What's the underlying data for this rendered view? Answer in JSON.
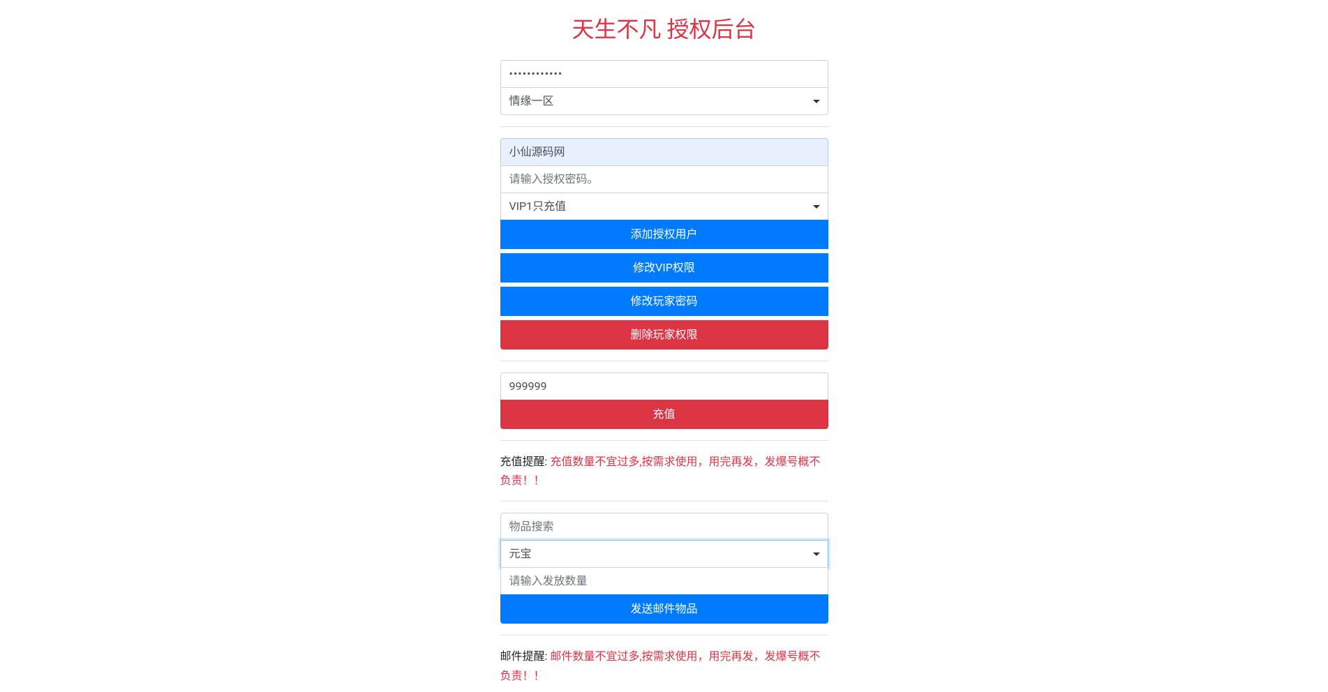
{
  "page": {
    "title": "天生不凡 授权后台"
  },
  "section1": {
    "password_value": "••••••••••••",
    "server_select_value": "情缘一区"
  },
  "section2": {
    "username_value": "小仙源码网",
    "auth_password_placeholder": "请输入授权密码。",
    "vip_select_value": "VIP1只充值",
    "btn_add_auth": "添加授权用户",
    "btn_modify_vip": "修改VIP权限",
    "btn_modify_password": "修改玩家密码",
    "btn_delete_auth": "删除玩家权限"
  },
  "section3": {
    "amount_value": "999999",
    "btn_recharge": "充值"
  },
  "recharge_alert": {
    "label": "充值提醒:",
    "content": "充值数量不宜过多,按需求使用，用完再发，发爆号概不负责！！"
  },
  "section4": {
    "item_search_placeholder": "物品搜索",
    "item_select_value": "元宝",
    "quantity_placeholder": "请输入发放数量",
    "btn_send_mail": "发送邮件物品"
  },
  "mail_alert": {
    "label": "邮件提醒:",
    "content": "邮件数量不宜过多,按需求使用，用完再发，发爆号概不负责！！"
  }
}
